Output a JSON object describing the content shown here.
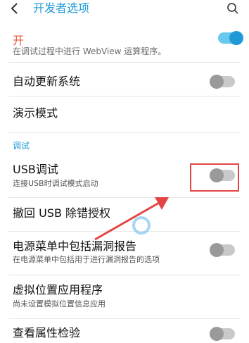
{
  "header": {
    "title": "开发者选项"
  },
  "master": {
    "label": "开",
    "toggle_on": true
  },
  "cutoff_text": "在调试过程中进行 WebView 运算程序。",
  "rows": {
    "auto_update": {
      "title": "自动更新系统"
    },
    "demo_mode": {
      "title": "演示模式"
    },
    "section_debug": "调试",
    "usb_debug": {
      "title": "USB调试",
      "subtitle": "连接USB时调试模式启动"
    },
    "revoke_usb": {
      "title": "撤回 USB 除错授权"
    },
    "bug_report": {
      "title": "电源菜单中包括漏洞报告",
      "subtitle": "在电源菜单中包括用于进行漏洞报告的选项"
    },
    "mock_location": {
      "title": "虚拟位置应用程序",
      "subtitle": "尚未设置模拟位置信息应用"
    },
    "view_attr": {
      "title": "查看属性检验"
    }
  },
  "colors": {
    "accent": "#1f9ad6",
    "master_label": "#e8543d",
    "highlight": "#e34545"
  }
}
